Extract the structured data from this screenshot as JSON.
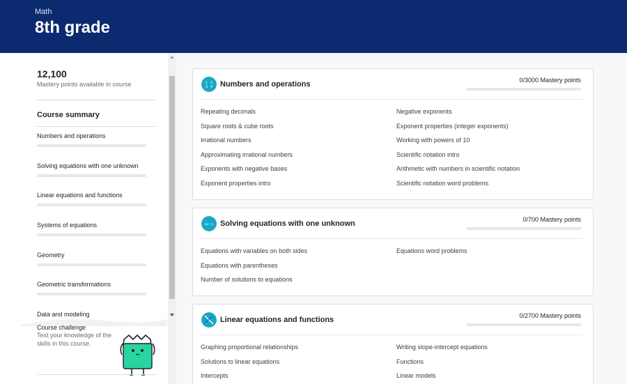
{
  "header": {
    "subject": "Math",
    "grade": "8th grade",
    "bg_color": "#0b2a6f"
  },
  "sidebar": {
    "points_value": "12,100",
    "points_label": "Mastery points available in course",
    "summary_title": "Course summary",
    "units": [
      {
        "label": "Numbers and operations"
      },
      {
        "label": "Solving equations with one unknown"
      },
      {
        "label": "Linear equations and functions"
      },
      {
        "label": "Systems of equations"
      },
      {
        "label": "Geometry"
      },
      {
        "label": "Geometric transformations"
      },
      {
        "label": "Data and modeling"
      }
    ],
    "challenge": {
      "title": "Course challenge",
      "description": "Test your knowledge of the skills in this course."
    }
  },
  "main": {
    "cards": [
      {
        "title": "Numbers and operations",
        "mastery": "0/3000 Mastery points",
        "icon": "numbers-icon",
        "icon_text": "1 2 3 4",
        "icon_color": "#1aa7c6",
        "skills_col1": [
          "Repeating decimals",
          "Square roots & cube roots",
          "Irrational numbers",
          "Approximating irrational numbers",
          "Exponents with negative bases",
          "Exponent properties intro"
        ],
        "skills_col2": [
          "Negative exponents",
          "Exponent properties (integer exponents)",
          "Working with powers of 10",
          "Scientific notation intro",
          "Arithmetic with numbers in scientific notation",
          "Scientific notation word problems"
        ]
      },
      {
        "title": "Solving equations with one unknown",
        "mastery": "0/700 Mastery points",
        "icon": "equation-icon",
        "icon_text": "3x + 4",
        "icon_color": "#1aa7c6",
        "skills_col1": [
          "Equations with variables on both sides",
          "Equations with parentheses",
          "Number of solutions to equations"
        ],
        "skills_col2": [
          "Equations word problems"
        ]
      },
      {
        "title": "Linear equations and functions",
        "mastery": "0/2700 Mastery points",
        "icon": "linear-graph-icon",
        "icon_color": "#1aa7c6",
        "skills_col1": [
          "Graphing proportional relationships",
          "Solutions to linear equations",
          "Intercepts"
        ],
        "skills_col2": [
          "Writing slope-intercept equations",
          "Functions",
          "Linear models"
        ]
      }
    ]
  }
}
